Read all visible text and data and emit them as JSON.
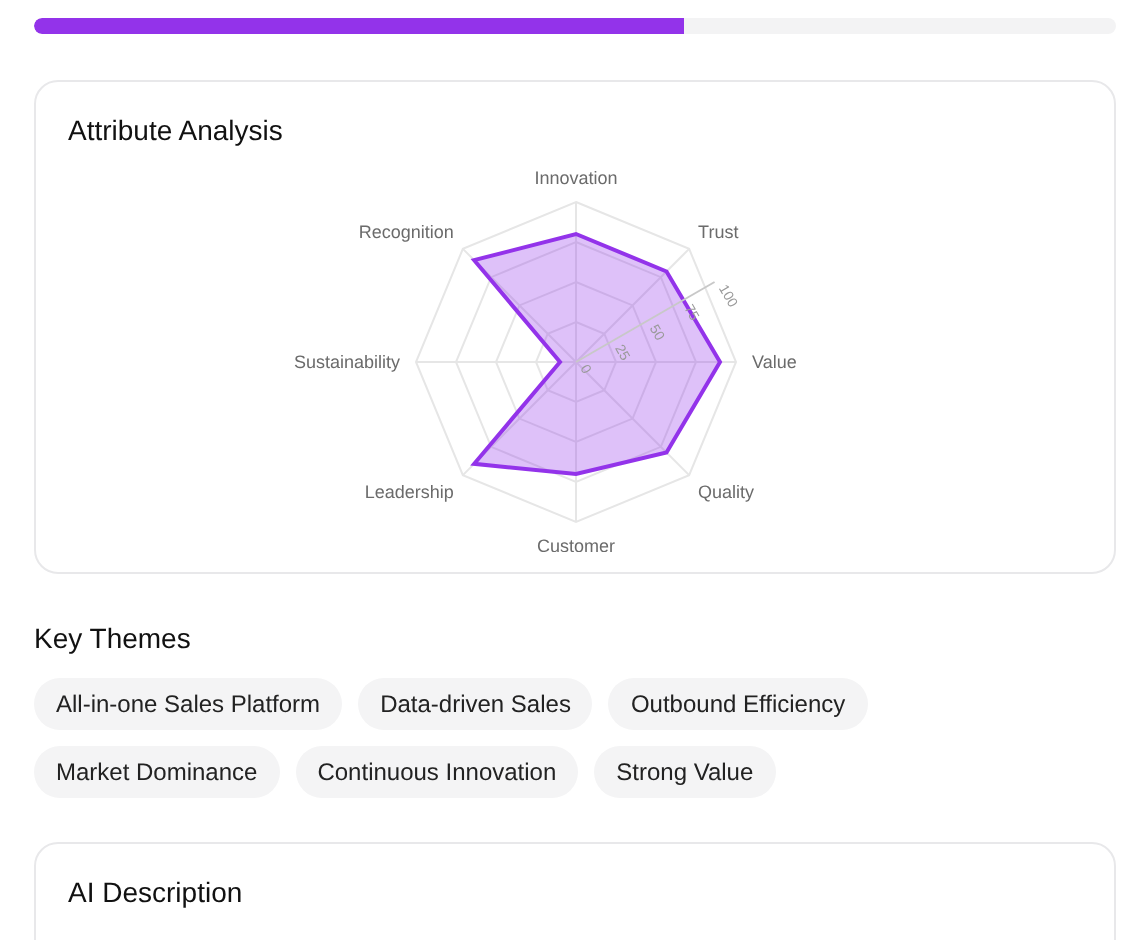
{
  "progress": {
    "level": 0.6
  },
  "attribute_analysis": {
    "title": "Attribute Analysis",
    "chart_data": {
      "type": "radar",
      "categories": [
        "Innovation",
        "Trust",
        "Value",
        "Quality",
        "Customer",
        "Leadership",
        "Sustainability",
        "Recognition"
      ],
      "series": [
        {
          "color": "#9333ea",
          "values": [
            80,
            80,
            90,
            80,
            70,
            90,
            10,
            90
          ]
        }
      ],
      "ylim": [
        0,
        100
      ],
      "yticks": [
        0,
        25,
        50,
        75,
        100
      ]
    }
  },
  "key_themes": {
    "title": "Key Themes",
    "tags": [
      "All-in-one Sales Platform",
      "Data-driven Sales",
      "Outbound Efficiency",
      "Market Dominance",
      "Continuous Innovation",
      "Strong Value"
    ]
  },
  "ai_description": {
    "title": "AI Description"
  }
}
